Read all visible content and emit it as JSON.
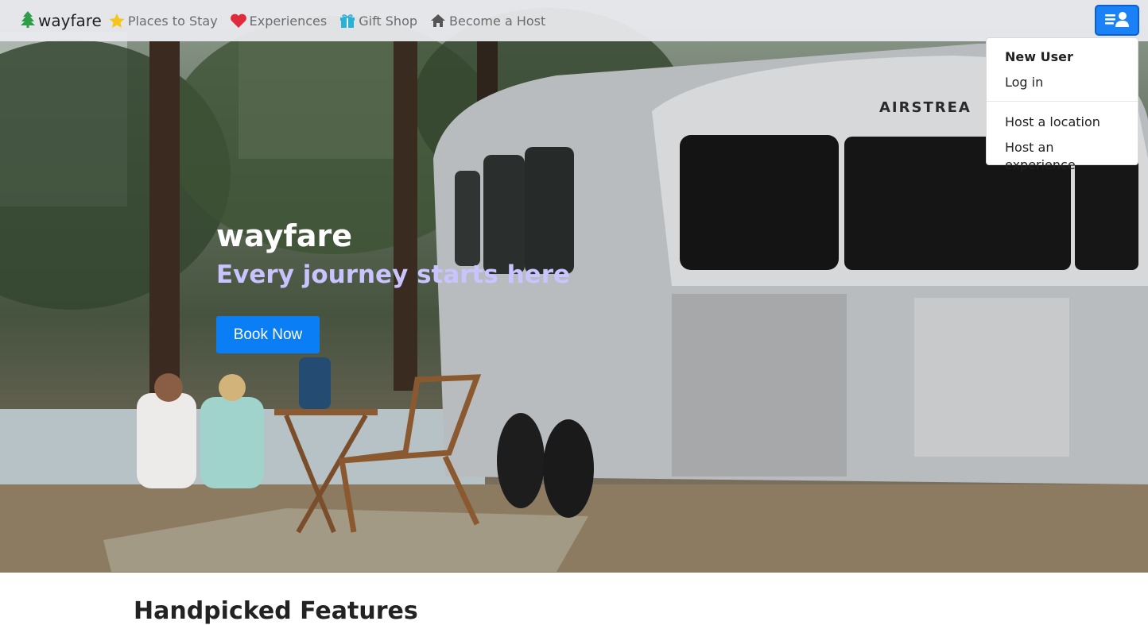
{
  "navbar": {
    "brand": {
      "icon": "tree-icon",
      "label": "wayfare"
    },
    "links": [
      {
        "icon": "star-icon",
        "label": "Places to Stay"
      },
      {
        "icon": "heart-icon",
        "label": "Experiences"
      },
      {
        "icon": "gift-icon",
        "label": "Gift Shop"
      },
      {
        "icon": "house-icon",
        "label": "Become a Host"
      }
    ],
    "user_menu_button": {
      "icon": "menu-user-icon"
    }
  },
  "user_dropdown": {
    "items": [
      {
        "label": "New User",
        "style": "bold"
      },
      {
        "label": "Log in"
      },
      {
        "label": "Host a location"
      },
      {
        "label": "Host an experience"
      }
    ]
  },
  "hero": {
    "title": "wayfare",
    "subtitle": "Every journey starts here",
    "cta_label": "Book Now"
  },
  "features": {
    "title": "Handpicked Features"
  },
  "colors": {
    "accent": "#0a7ef5",
    "subtitle": "#c9c3ff",
    "tree": "#2e9d48",
    "star": "#f5c518",
    "heart": "#e02b3c",
    "gift": "#2bb1d6",
    "house": "#555555"
  }
}
